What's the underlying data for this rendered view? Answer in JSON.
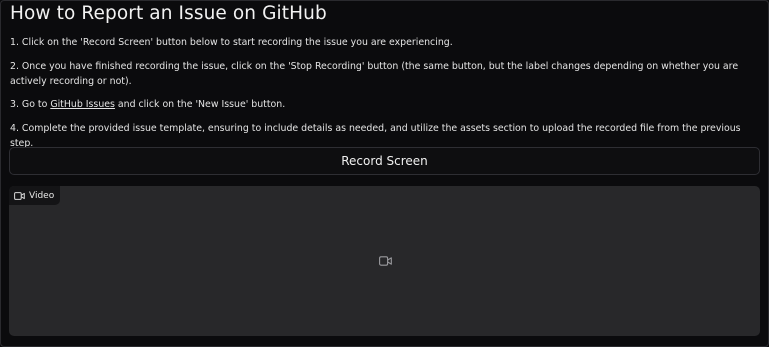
{
  "page": {
    "title": "How to Report an Issue on GitHub"
  },
  "steps": [
    {
      "text": "1. Click on the 'Record Screen' button below to start recording the issue you are experiencing."
    },
    {
      "text": "2. Once you have finished recording the issue, click on the 'Stop Recording' button (the same button, but the label changes depending on whether you are actively recording or not)."
    },
    {
      "prefix": "3. Go to ",
      "link": "GitHub Issues",
      "suffix": " and click on the 'New Issue' button."
    },
    {
      "text": "4. Complete the provided issue template, ensuring to include details as needed, and utilize the assets section to upload the recorded file from the previous step."
    }
  ],
  "record_button": {
    "label": "Record Screen"
  },
  "video": {
    "label": "Video",
    "label_icon": "video-camera-icon",
    "placeholder_icon": "video-camera-icon"
  },
  "colors": {
    "background": "#0b0b0d",
    "panel": "#28282a",
    "text": "#ececec"
  }
}
